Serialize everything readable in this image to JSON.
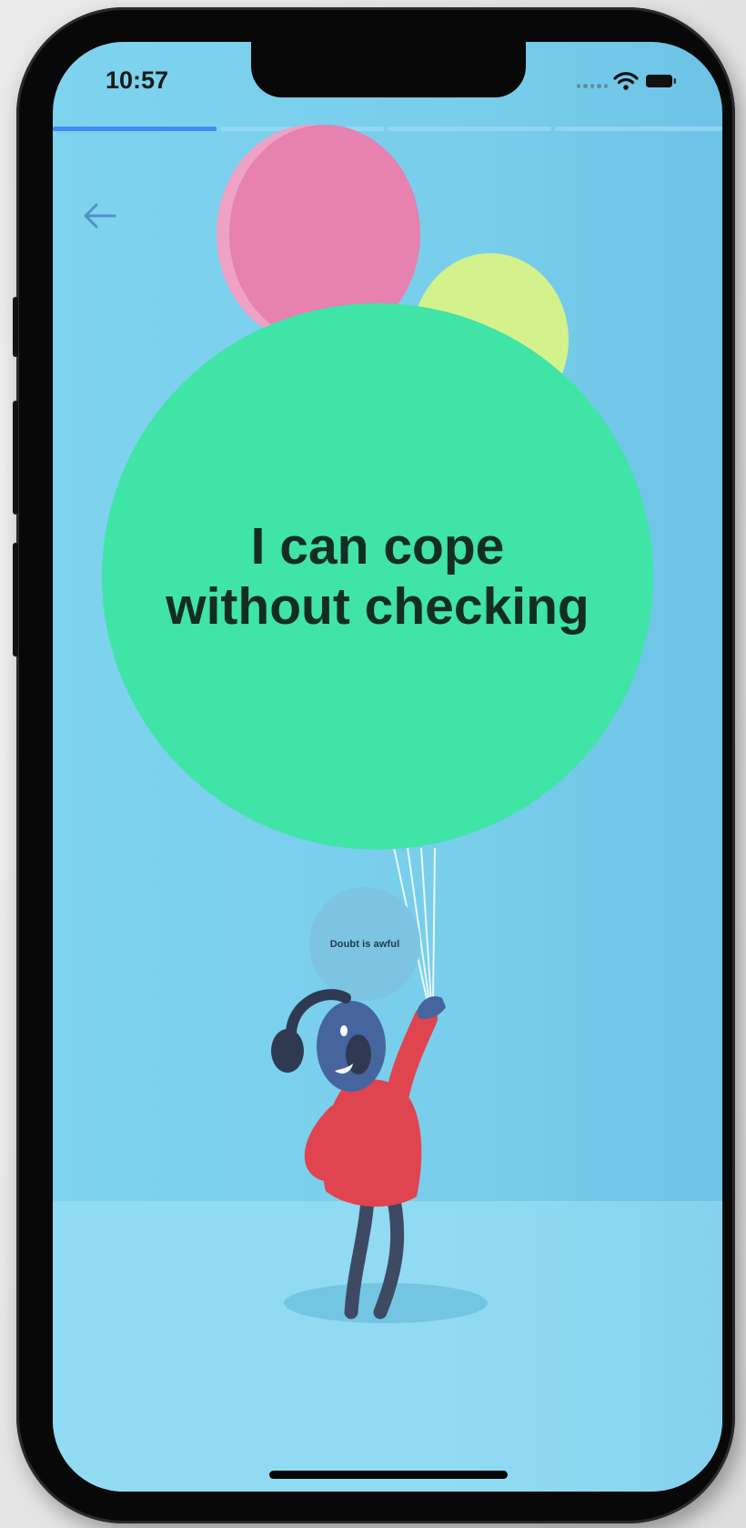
{
  "status_bar": {
    "time": "10:57"
  },
  "progress": {
    "total_steps": 4,
    "current_step": 1,
    "active_color": "#3f8df0",
    "inactive_color": "#9bdcf4"
  },
  "navigation": {
    "back_icon": "arrow-left-icon"
  },
  "main_balloon": {
    "text_line_1": "I can cope",
    "text_line_2": "without checking",
    "color": "#3fe4a6"
  },
  "small_balloon": {
    "text": "Doubt is awful"
  },
  "colors": {
    "sky": "#7ed3ef",
    "floor": "#92dcf3",
    "pink_balloon": "#e681b0",
    "yellow_balloon": "#d4f28c",
    "character_shirt": "#e0444f",
    "character_skin": "#46659f"
  }
}
